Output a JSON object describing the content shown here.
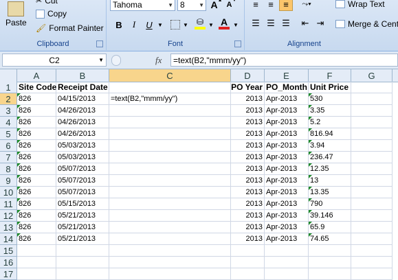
{
  "ribbon": {
    "clipboard": {
      "label": "Clipboard",
      "paste": "Paste",
      "cut": "Cut",
      "copy": "Copy",
      "format_painter": "Format Painter"
    },
    "font": {
      "label": "Font",
      "font_name": "Tahoma",
      "font_size": "8",
      "grow": "A",
      "shrink": "A",
      "bold": "B",
      "italic": "I",
      "underline": "U",
      "font_color_glyph": "A",
      "font_color": "#e02020",
      "fill_color": "#ffff00"
    },
    "alignment": {
      "label": "Alignment",
      "wrap_text": "Wrap Text",
      "merge_center": "Merge & Cent"
    }
  },
  "formula_bar": {
    "name_box": "C2",
    "fx": "fx",
    "formula": "=text(B2,\"mmm/yy\")"
  },
  "columns": [
    "A",
    "B",
    "C",
    "D",
    "E",
    "F",
    "G"
  ],
  "selected_column": "C",
  "selected_row": "2",
  "rows": [
    {
      "num": "1",
      "a": "Site Code",
      "b": "Receipt Date",
      "c": "",
      "d": "PO Year",
      "e": "PO_Month",
      "f": "Unit Price"
    },
    {
      "num": "2",
      "a": "826",
      "b": "04/15/2013",
      "c": "=text(B2,\"mmm/yy\")",
      "d": "2013",
      "e": "Apr-2013",
      "f": "530"
    },
    {
      "num": "3",
      "a": "826",
      "b": "04/26/2013",
      "c": "",
      "d": "2013",
      "e": "Apr-2013",
      "f": "3.35"
    },
    {
      "num": "4",
      "a": "826",
      "b": "04/26/2013",
      "c": "",
      "d": "2013",
      "e": "Apr-2013",
      "f": "5.2"
    },
    {
      "num": "5",
      "a": "826",
      "b": "04/26/2013",
      "c": "",
      "d": "2013",
      "e": "Apr-2013",
      "f": "816.94"
    },
    {
      "num": "6",
      "a": "826",
      "b": "05/03/2013",
      "c": "",
      "d": "2013",
      "e": "Apr-2013",
      "f": "3.94"
    },
    {
      "num": "7",
      "a": "826",
      "b": "05/03/2013",
      "c": "",
      "d": "2013",
      "e": "Apr-2013",
      "f": "236.47"
    },
    {
      "num": "8",
      "a": "826",
      "b": "05/07/2013",
      "c": "",
      "d": "2013",
      "e": "Apr-2013",
      "f": "12.35"
    },
    {
      "num": "9",
      "a": "826",
      "b": "05/07/2013",
      "c": "",
      "d": "2013",
      "e": "Apr-2013",
      "f": "13"
    },
    {
      "num": "10",
      "a": "826",
      "b": "05/07/2013",
      "c": "",
      "d": "2013",
      "e": "Apr-2013",
      "f": "13.35"
    },
    {
      "num": "11",
      "a": "826",
      "b": "05/15/2013",
      "c": "",
      "d": "2013",
      "e": "Apr-2013",
      "f": "790"
    },
    {
      "num": "12",
      "a": "826",
      "b": "05/21/2013",
      "c": "",
      "d": "2013",
      "e": "Apr-2013",
      "f": "39.146"
    },
    {
      "num": "13",
      "a": "826",
      "b": "05/21/2013",
      "c": "",
      "d": "2013",
      "e": "Apr-2013",
      "f": "65.9"
    },
    {
      "num": "14",
      "a": "826",
      "b": "05/21/2013",
      "c": "",
      "d": "2013",
      "e": "Apr-2013",
      "f": "74.65"
    },
    {
      "num": "15",
      "a": "",
      "b": "",
      "c": "",
      "d": "",
      "e": "",
      "f": ""
    },
    {
      "num": "16",
      "a": "",
      "b": "",
      "c": "",
      "d": "",
      "e": "",
      "f": ""
    },
    {
      "num": "17",
      "a": "",
      "b": "",
      "c": "",
      "d": "",
      "e": "",
      "f": ""
    }
  ]
}
